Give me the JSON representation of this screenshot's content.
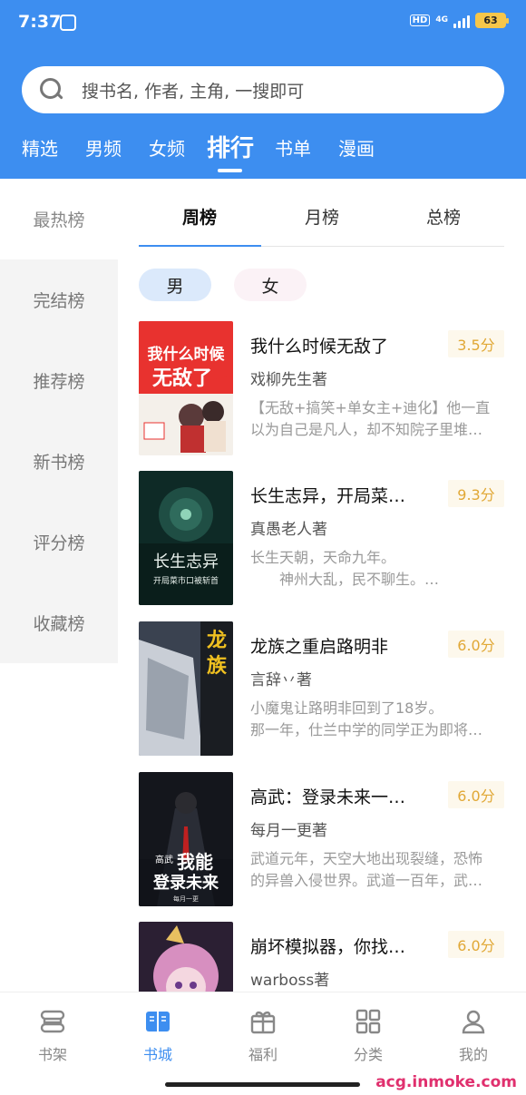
{
  "status": {
    "time": "7:37",
    "hd": "HD",
    "network": "4G",
    "battery": "63"
  },
  "search": {
    "placeholder": "搜书名, 作者, 主角, 一搜即可"
  },
  "top_tabs": [
    "精选",
    "男频",
    "女频",
    "排行",
    "书单",
    "漫画"
  ],
  "active_top_tab": "排行",
  "sidebar": [
    "最热榜",
    "完结榜",
    "推荐榜",
    "新书榜",
    "评分榜",
    "收藏榜"
  ],
  "sub_tabs": [
    "周榜",
    "月榜",
    "总榜"
  ],
  "gender": {
    "male": "男",
    "female": "女"
  },
  "books": [
    {
      "title": "我什么时候无敌了",
      "score": "3.5分",
      "author": "戏柳先生著",
      "desc1": "【无敌+搞笑+单女主+迪化】他一直",
      "desc2": "以为自己是凡人，却不知院子里堆…",
      "cover": {
        "text1": "我什么时候",
        "text2": "无敌了"
      }
    },
    {
      "title": "长生志异，开局菜…",
      "score": "9.3分",
      "author": "真愚老人著",
      "desc1": "长生天朝，天命九年。",
      "desc2": "　　神州大乱，民不聊生。…",
      "cover": {
        "text1": "长生志异",
        "text2": "开局菜市口被斩首"
      }
    },
    {
      "title": "龙族之重启路明非",
      "score": "6.0分",
      "author": "言辞丷著",
      "desc1": "小魔鬼让路明非回到了18岁。",
      "desc2": "那一年，仕兰中学的同学正为即将…",
      "cover": {
        "text1": "龙族"
      }
    },
    {
      "title": "高武：登录未来一…",
      "score": "6.0分",
      "author": "每月一更著",
      "desc1": "武道元年，天空大地出现裂缝，恐怖",
      "desc2": "的异兽入侵世界。武道一百年，武…",
      "cover": {
        "text1": "高武",
        "text2": "我能",
        "text3": "登录未来",
        "text4": "每月一更"
      }
    },
    {
      "title": "崩坏模拟器，你找…",
      "score": "6.0分",
      "author": "warboss著",
      "desc1": "",
      "desc2": "",
      "cover": {}
    }
  ],
  "bottom_nav": [
    "书架",
    "书城",
    "福利",
    "分类",
    "我的"
  ],
  "active_nav": "书城",
  "watermark": "acg.inmoke.com",
  "colors": {
    "primary": "#3d8ef0",
    "score": "#e1a836",
    "sidebar_bg": "#f4f4f4"
  }
}
